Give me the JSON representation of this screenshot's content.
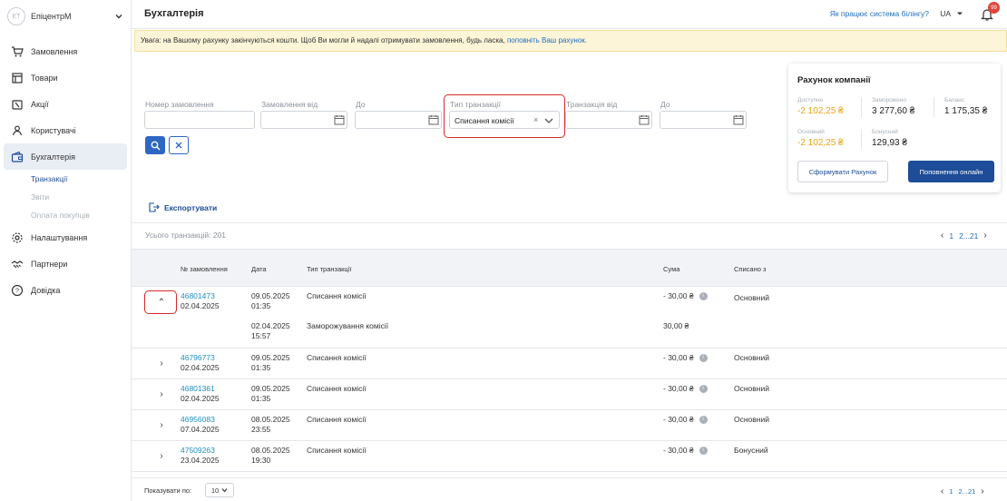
{
  "company": {
    "initials": "ЕТ",
    "name": "ЕпіцентрМ"
  },
  "sidebar": {
    "items": [
      {
        "label": "Замовлення",
        "icon": "cart-icon"
      },
      {
        "label": "Товари",
        "icon": "products-icon"
      },
      {
        "label": "Акції",
        "icon": "promo-icon"
      },
      {
        "label": "Користувачі",
        "icon": "users-icon"
      },
      {
        "label": "Бухгалтерія",
        "icon": "wallet-icon",
        "active": true
      },
      {
        "label": "Налаштування",
        "icon": "gear-icon"
      },
      {
        "label": "Партнери",
        "icon": "handshake-icon"
      },
      {
        "label": "Довідка",
        "icon": "help-icon"
      }
    ],
    "sub_items": [
      {
        "label": "Транзакції",
        "active": true
      },
      {
        "label": "Звіти"
      },
      {
        "label": "Оплата покупців"
      }
    ]
  },
  "header": {
    "title": "Бухгалтерія",
    "help_link": "Як працює система білінгу?",
    "lang": "UA",
    "notifications": "99"
  },
  "warning": {
    "text": "Увага: на Вашому рахунку закінчуються кошти. Щоб Ви могли й надалі отримувати замовлення, будь ласка, ",
    "link": "поповніть Ваш рахунок."
  },
  "filters": {
    "order_number_label": "Номер замовлення",
    "order_from_label": "Замовлення від",
    "order_to_label": "До",
    "type_label": "Тип транзакції",
    "type_value": "Списання комісії",
    "trans_from_label": "Транзакція від",
    "trans_to_label": "До"
  },
  "account": {
    "title": "Рахунок компанії",
    "available_label": "Доступно",
    "available_value": "-2 102,25 ₴",
    "frozen_label": "Заморожено",
    "frozen_value": "3 277,60 ₴",
    "balance_label": "Баланс",
    "balance_value": "1 175,35 ₴",
    "main_label": "Основний",
    "main_value": "-2 102,25 ₴",
    "bonus_label": "Бонусний",
    "bonus_value": "129,93 ₴",
    "generate_btn": "Сформувати Рахунок",
    "topup_btn": "Поповнення онлайн"
  },
  "export_label": "Експортувати",
  "total_text": "Усього транзакцій: 201",
  "pager": {
    "current": "1",
    "rest": "2...21",
    "prev": "‹",
    "next": "›"
  },
  "table": {
    "headers": {
      "order": "№ замовлення",
      "date": "Дата",
      "type": "Тип транзакції",
      "sum": "Сума",
      "from": "Списано з"
    },
    "rows": [
      {
        "order": "46801473",
        "order_date": "02.04.2025",
        "date": "09.05.2025",
        "time": "01:35",
        "type": "Списання комісії",
        "sum": "- 30,00 ₴",
        "from": "Основний",
        "expanded": true
      },
      {
        "order": "",
        "order_date": "",
        "date": "02.04.2025",
        "time": "15:57",
        "type": "Заморожування комісії",
        "sum": "30,00 ₴",
        "from": ""
      },
      {
        "order": "46796773",
        "order_date": "02.04.2025",
        "date": "09.05.2025",
        "time": "01:35",
        "type": "Списання комісії",
        "sum": "- 30,00 ₴",
        "from": "Основний"
      },
      {
        "order": "46801361",
        "order_date": "02.04.2025",
        "date": "09.05.2025",
        "time": "01:35",
        "type": "Списання комісії",
        "sum": "- 30,00 ₴",
        "from": "Основний"
      },
      {
        "order": "46956083",
        "order_date": "07.04.2025",
        "date": "08.05.2025",
        "time": "23:55",
        "type": "Списання комісії",
        "sum": "- 30,00 ₴",
        "from": "Основний"
      },
      {
        "order": "47509263",
        "order_date": "23.04.2025",
        "date": "08.05.2025",
        "time": "19:30",
        "type": "Списання комісії",
        "sum": "- 30,00 ₴",
        "from": "Бонусний"
      }
    ]
  },
  "footer": {
    "per_page_label": "Показувати по:",
    "per_page_value": "10"
  }
}
